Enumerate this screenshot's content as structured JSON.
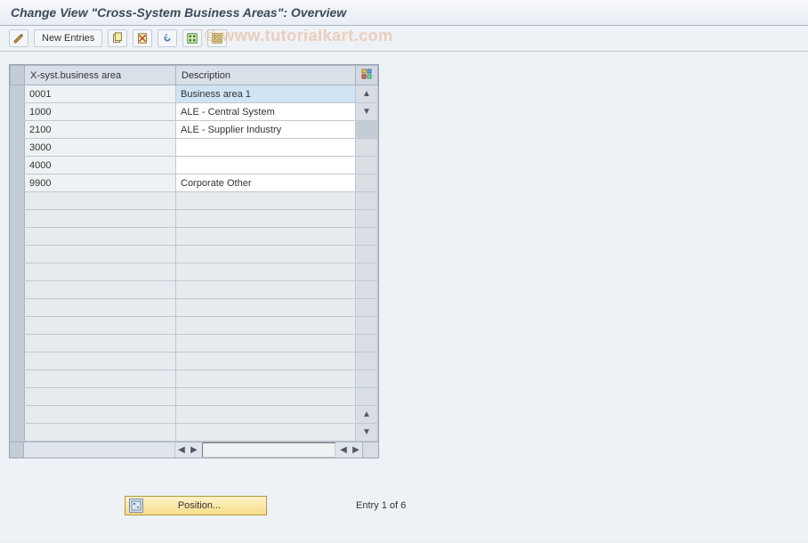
{
  "header": {
    "title": "Change View \"Cross-System Business Areas\": Overview"
  },
  "toolbar": {
    "new_entries_label": "New Entries"
  },
  "table": {
    "columns": {
      "code": "X-syst.business area",
      "desc": "Description"
    },
    "rows": [
      {
        "code": "0001",
        "desc": "Business area 1",
        "selected": true
      },
      {
        "code": "1000",
        "desc": "ALE - Central System",
        "selected": false
      },
      {
        "code": "2100",
        "desc": "ALE - Supplier Industry",
        "selected": false
      },
      {
        "code": "3000",
        "desc": "",
        "selected": false
      },
      {
        "code": "4000",
        "desc": "",
        "selected": false
      },
      {
        "code": "9900",
        "desc": "Corporate Other",
        "selected": false
      }
    ],
    "empty_rows": 14
  },
  "footer": {
    "position_label": "Position...",
    "entry_text": "Entry 1 of 6"
  },
  "watermark": "© www.tutorialkart.com"
}
